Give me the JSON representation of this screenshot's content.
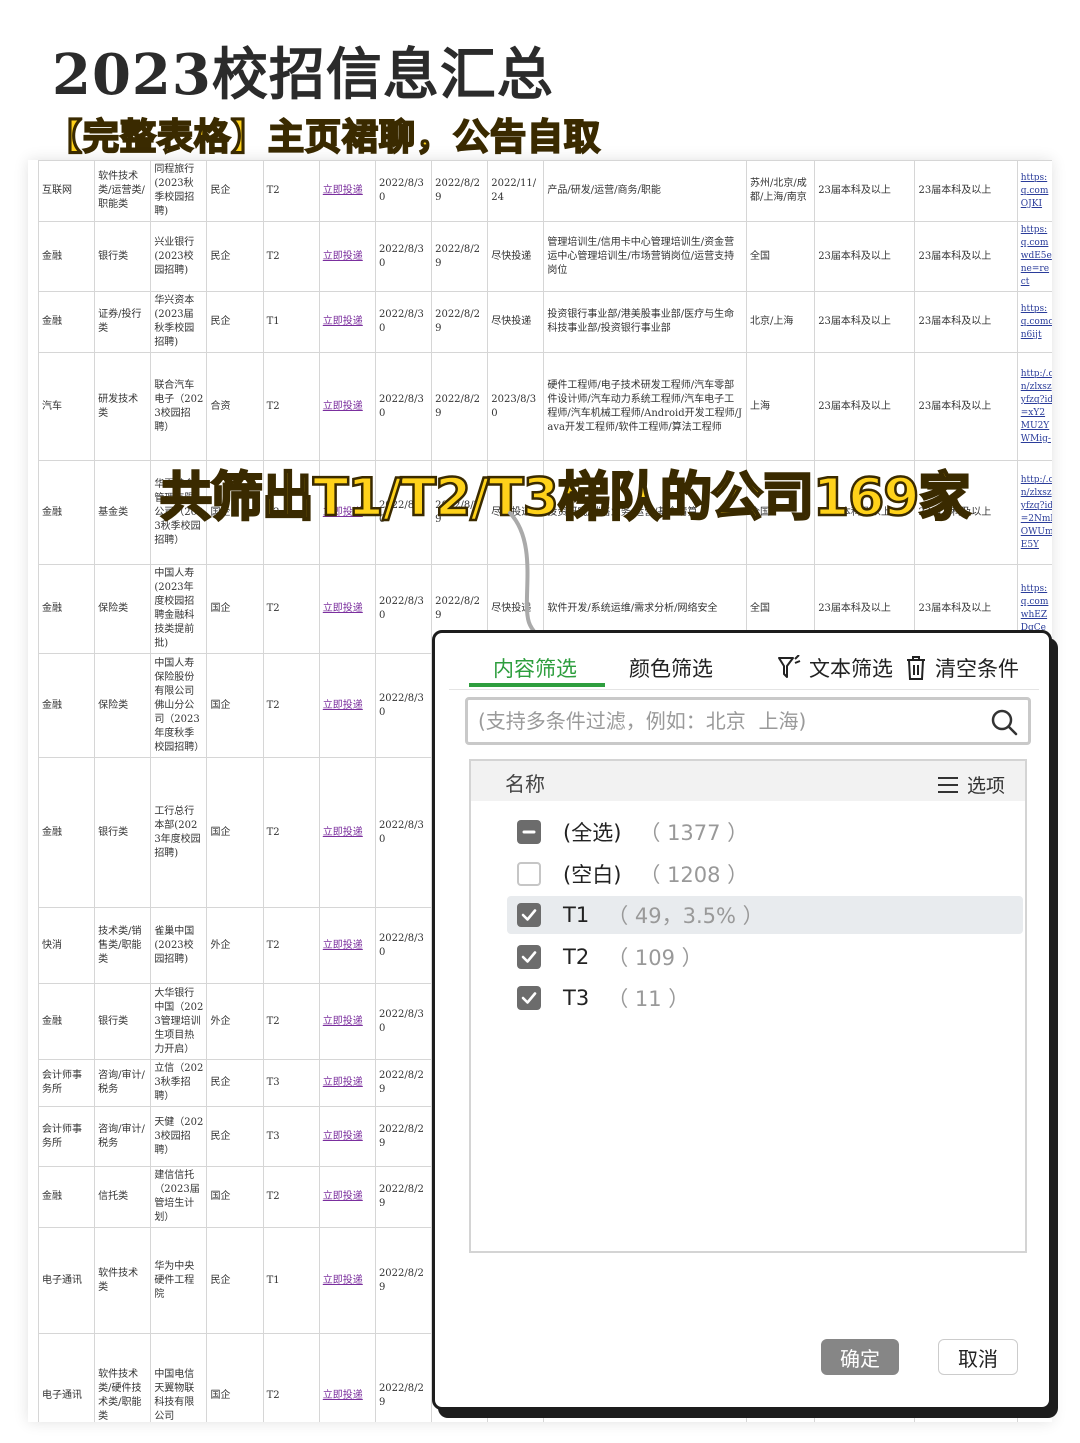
{
  "header": {
    "title": "2023校招信息汇总",
    "subtitle": "【完整表格】主页裙聊，公告自取"
  },
  "table": {
    "rows": [
      {
        "h": 58,
        "cells": [
          "互联网",
          "软件技术类/运营类/职能类",
          "同程旅行(2023秋季校园招聘)",
          "民企",
          "T2",
          "立即投递",
          "2022/8/30",
          "2022/8/29",
          "2022/11/24",
          "产品/研发/运营/商务/职能",
          "苏州/北京/成都/上海/南京",
          "23届本科及以上",
          "23届本科及以上",
          "https:q.comOJKI"
        ]
      },
      {
        "h": 68,
        "cells": [
          "金融",
          "银行类",
          "兴业银行(2023校园招聘)",
          "民企",
          "T2",
          "立即投递",
          "2022/8/30",
          "2022/8/29",
          "尽快投递",
          "管理培训生/信用卡中心管理培训生/资金营运中心管理培训生/市场营销岗位/运营支持岗位",
          "全国",
          "23届本科及以上",
          "23届本科及以上",
          "https:q.comwdE5ene=rect"
        ]
      },
      {
        "h": 58,
        "cells": [
          "金融",
          "证券/投行类",
          "华兴资本(2023届秋季校园招聘)",
          "民企",
          "T1",
          "立即投递",
          "2022/8/30",
          "2022/8/29",
          "尽快投递",
          "投资银行事业部/港美股事业部/医疗与生命科技事业部/投资银行事业部",
          "北京/上海",
          "23届本科及以上",
          "23届本科及以上",
          "https:q.comcn6ijt"
        ]
      },
      {
        "h": 108,
        "cells": [
          "汽车",
          "研发技术类",
          "联合汽车电子（2023校园招聘）",
          "合资",
          "T2",
          "立即投递",
          "2022/8/30",
          "2022/8/29",
          "2023/8/30",
          "硬件工程师/电子技术研发工程师/汽车零部件设计师/汽车动力系统工程师/汽车电子工程师/汽车机械工程师/Android开发工程师/Java开发工程师/软件工程师/算法工程师",
          "上海",
          "23届本科及以上",
          "23届本科及以上",
          "http:/.cn/zlxszyfzq?id=xY2MU2YWMig-"
        ]
      },
      {
        "h": 104,
        "cells": [
          "金融",
          "基金类",
          "华夏基金管理有限公司（2023秋季校园招聘）",
          "国企",
          "T2",
          "立即投递",
          "2022/8/30",
          "2022/8/29",
          "尽快投递",
          "投资研究/销售业务/运营/基金清算",
          "全国",
          "23届本科及以上",
          "23届本科及以上",
          "http:/.cn/zlxszyfzq?id=2NmlOWUmE5Y"
        ]
      },
      {
        "h": 76,
        "cells": [
          "金融",
          "保险类",
          "中国人寿(2023年度校园招聘金融科技类提前批)",
          "国企",
          "T2",
          "立即投递",
          "2022/8/30",
          "2022/8/29",
          "尽快投递",
          "软件开发/系统运维/需求分析/网络安全",
          "全国",
          "23届本科及以上",
          "23届本科及以上",
          "https:q.comwhEZDgCe"
        ]
      },
      {
        "h": 104,
        "cells": [
          "金融",
          "保险类",
          "中国人寿保险股份有限公司佛山分公司（2023年度秋季校园招聘）",
          "国企",
          "T2",
          "立即投递",
          "2022/8/30",
          "",
          "",
          "",
          "",
          "",
          "",
          ""
        ]
      },
      {
        "h": 150,
        "cells": [
          "金融",
          "银行类",
          "工行总行本部(2023年度校园招聘)",
          "国企",
          "T2",
          "立即投递",
          "2022/8/30",
          "",
          "",
          "",
          "",
          "",
          "",
          ""
        ]
      },
      {
        "h": 76,
        "cells": [
          "快消",
          "技术类/销售类/职能类",
          "雀巢中国(2023校园招聘)",
          "外企",
          "T2",
          "立即投递",
          "2022/8/30",
          "",
          "",
          "",
          "",
          "",
          "",
          ""
        ]
      },
      {
        "h": 76,
        "cells": [
          "金融",
          "银行类",
          "大华银行中国（2023管理培训生项目热力开启）",
          "外企",
          "T2",
          "立即投递",
          "2022/8/30",
          "",
          "",
          "",
          "",
          "",
          "",
          ""
        ]
      },
      {
        "h": 44,
        "cells": [
          "会计师事务所",
          "咨询/审计/税务",
          "立信（2023秋季招聘）",
          "民企",
          "T3",
          "立即投递",
          "2022/8/29",
          "",
          "",
          "",
          "",
          "",
          "",
          ""
        ]
      },
      {
        "h": 60,
        "cells": [
          "会计师事务所",
          "咨询/审计/税务",
          "天健（2023校园招聘）",
          "民企",
          "T3",
          "立即投递",
          "2022/8/29",
          "",
          "",
          "",
          "",
          "",
          "",
          ""
        ]
      },
      {
        "h": 46,
        "cells": [
          "金融",
          "信托类",
          "建信信托（2023届管培生计划）",
          "国企",
          "T2",
          "立即投递",
          "2022/8/29",
          "",
          "",
          "",
          "",
          "",
          "",
          ""
        ]
      },
      {
        "h": 106,
        "cells": [
          "电子通讯",
          "软件技术类",
          "华为中央硬件工程院",
          "民企",
          "T1",
          "立即投递",
          "2022/8/29",
          "",
          "",
          "",
          "",
          "",
          "",
          ""
        ]
      },
      {
        "h": 124,
        "cells": [
          "电子通讯",
          "软件技术类/硬件技术类/职能类",
          "中国电信天翼物联科技有限公司",
          "国企",
          "T2",
          "立即投递",
          "2022/8/29",
          "",
          "",
          "",
          "",
          "",
          "",
          ""
        ]
      }
    ]
  },
  "banner": {
    "text": "共筛出T1/T2/T3梯队的公司169家"
  },
  "filter_dialog": {
    "tabs": [
      {
        "label": "内容筛选",
        "active": true
      },
      {
        "label": "颜色筛选",
        "active": false
      }
    ],
    "text_filter_label": "文本筛选",
    "clear_label": "清空条件",
    "search_placeholder": "(支持多条件过滤，例如：北京  上海)",
    "list_header": "名称",
    "options_label": "选项",
    "items": [
      {
        "label": "(全选)",
        "count": "（ 1377 ）",
        "state": "partial",
        "highlight": false
      },
      {
        "label": "(空白)",
        "count": "（ 1208 ）",
        "state": "empty",
        "highlight": false
      },
      {
        "label": "T1",
        "count": "（ 49，3.5% ）",
        "state": "checked",
        "highlight": true
      },
      {
        "label": "T2",
        "count": "（ 109 ）",
        "state": "checked",
        "highlight": false
      },
      {
        "label": "T3",
        "count": "（ 11 ）",
        "state": "checked",
        "highlight": false
      }
    ],
    "ok_label": "确定",
    "cancel_label": "取消",
    "colors": {
      "accent": "#2e9e3e",
      "button_gray": "#868686"
    }
  }
}
